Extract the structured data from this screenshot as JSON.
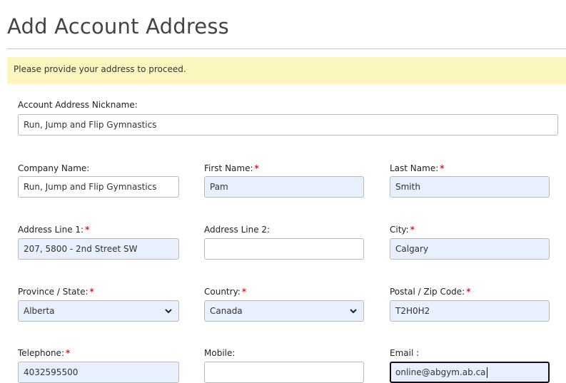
{
  "page": {
    "title": "Add Account Address",
    "notice": "Please provide your address to proceed."
  },
  "fields": {
    "nickname": {
      "label": "Account Address Nickname:",
      "value": "Run, Jump and Flip Gymnastics"
    },
    "company": {
      "label": "Company Name:",
      "value": "Run, Jump and Flip Gymnastics"
    },
    "first_name": {
      "label": "First Name:",
      "value": "Pam",
      "required": "*"
    },
    "last_name": {
      "label": "Last Name:",
      "value": "Smith",
      "required": "*"
    },
    "address1": {
      "label": "Address Line 1:",
      "value": "207, 5800 - 2nd Street SW",
      "required": "*"
    },
    "address2": {
      "label": "Address Line 2:",
      "value": ""
    },
    "city": {
      "label": "City:",
      "value": "Calgary",
      "required": "*"
    },
    "province": {
      "label": "Province / State:",
      "value": "Alberta",
      "required": "*"
    },
    "country": {
      "label": "Country:",
      "value": "Canada",
      "required": "*"
    },
    "postal": {
      "label": "Postal / Zip Code:",
      "value": "T2H0H2",
      "required": "*"
    },
    "telephone": {
      "label": "Telephone:",
      "value": "4032595500",
      "required": "*"
    },
    "mobile": {
      "label": "Mobile:",
      "value": ""
    },
    "email": {
      "label": "Email :",
      "value": "online@abgym.ab.ca"
    }
  },
  "icons": {
    "select_arrow": "chevron-down-icon"
  },
  "colors": {
    "notice_bg": "#fbf7bf",
    "autofill_bg": "#e8f0fe",
    "required_marker": "#e02020"
  }
}
